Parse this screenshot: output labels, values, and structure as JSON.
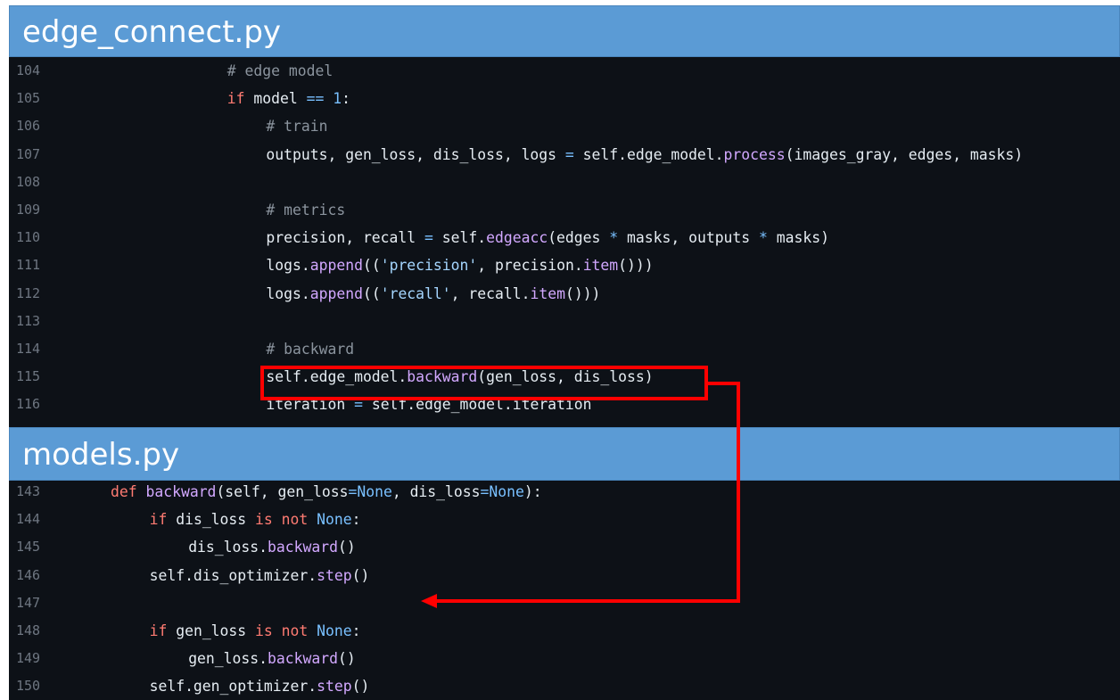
{
  "files": {
    "top": "edge_connect.py",
    "bottom": "models.py"
  },
  "colors": {
    "banner": "#5b9bd5",
    "code_bg": "#0d1117",
    "highlight": "#ff0000"
  },
  "top_code": [
    {
      "ln": "104",
      "indent": 16,
      "tokens": [
        [
          "cm",
          "# edge model"
        ]
      ]
    },
    {
      "ln": "105",
      "indent": 16,
      "tokens": [
        [
          "kw",
          "if"
        ],
        [
          "",
          " model "
        ],
        [
          "op",
          "=="
        ],
        [
          "",
          " "
        ],
        [
          "num",
          "1"
        ],
        [
          "",
          ":"
        ]
      ]
    },
    {
      "ln": "106",
      "indent": 20,
      "tokens": [
        [
          "cm",
          "# train"
        ]
      ]
    },
    {
      "ln": "107",
      "indent": 20,
      "tokens": [
        [
          "",
          "outputs, gen_loss, dis_loss, logs "
        ],
        [
          "op",
          "="
        ],
        [
          "",
          " self.edge_model."
        ],
        [
          "fn",
          "process"
        ],
        [
          "",
          "(images_gray, edges, masks)"
        ]
      ]
    },
    {
      "ln": "108",
      "indent": 0,
      "tokens": []
    },
    {
      "ln": "109",
      "indent": 20,
      "tokens": [
        [
          "cm",
          "# metrics"
        ]
      ]
    },
    {
      "ln": "110",
      "indent": 20,
      "tokens": [
        [
          "",
          "precision, recall "
        ],
        [
          "op",
          "="
        ],
        [
          "",
          " self."
        ],
        [
          "fn",
          "edgeacc"
        ],
        [
          "",
          "(edges "
        ],
        [
          "op",
          "*"
        ],
        [
          "",
          " masks, outputs "
        ],
        [
          "op",
          "*"
        ],
        [
          "",
          " masks)"
        ]
      ]
    },
    {
      "ln": "111",
      "indent": 20,
      "tokens": [
        [
          "",
          "logs."
        ],
        [
          "fn",
          "append"
        ],
        [
          "",
          "(("
        ],
        [
          "str",
          "'precision'"
        ],
        [
          "",
          ", precision."
        ],
        [
          "fn",
          "item"
        ],
        [
          "",
          "()))"
        ]
      ]
    },
    {
      "ln": "112",
      "indent": 20,
      "tokens": [
        [
          "",
          "logs."
        ],
        [
          "fn",
          "append"
        ],
        [
          "",
          "(("
        ],
        [
          "str",
          "'recall'"
        ],
        [
          "",
          ", recall."
        ],
        [
          "fn",
          "item"
        ],
        [
          "",
          "()))"
        ]
      ]
    },
    {
      "ln": "113",
      "indent": 0,
      "tokens": []
    },
    {
      "ln": "114",
      "indent": 20,
      "tokens": [
        [
          "cm",
          "# backward"
        ]
      ]
    },
    {
      "ln": "115",
      "indent": 20,
      "tokens": [
        [
          "",
          "self.edge_model."
        ],
        [
          "fn",
          "backward"
        ],
        [
          "",
          "(gen_loss, dis_loss)"
        ]
      ]
    },
    {
      "ln": "116",
      "indent": 20,
      "tokens": [
        [
          "",
          "iteration "
        ],
        [
          "op",
          "="
        ],
        [
          "",
          " self.edge_model.iteration"
        ]
      ]
    }
  ],
  "bottom_code": [
    {
      "ln": "143",
      "indent": 4,
      "tokens": [
        [
          "kw",
          "def"
        ],
        [
          "",
          " "
        ],
        [
          "fn",
          "backward"
        ],
        [
          "",
          "(self, gen_loss"
        ],
        [
          "op",
          "="
        ],
        [
          "num",
          "None"
        ],
        [
          "",
          ", dis_loss"
        ],
        [
          "op",
          "="
        ],
        [
          "num",
          "None"
        ],
        [
          "",
          "):"
        ]
      ]
    },
    {
      "ln": "144",
      "indent": 8,
      "tokens": [
        [
          "kw",
          "if"
        ],
        [
          "",
          " dis_loss "
        ],
        [
          "kw",
          "is not"
        ],
        [
          "",
          " "
        ],
        [
          "num",
          "None"
        ],
        [
          "",
          ":"
        ]
      ]
    },
    {
      "ln": "145",
      "indent": 12,
      "tokens": [
        [
          "",
          "dis_loss."
        ],
        [
          "fn",
          "backward"
        ],
        [
          "",
          "()"
        ]
      ]
    },
    {
      "ln": "146",
      "indent": 8,
      "tokens": [
        [
          "",
          "self.dis_optimizer."
        ],
        [
          "fn",
          "step"
        ],
        [
          "",
          "()"
        ]
      ]
    },
    {
      "ln": "147",
      "indent": 0,
      "tokens": []
    },
    {
      "ln": "148",
      "indent": 8,
      "tokens": [
        [
          "kw",
          "if"
        ],
        [
          "",
          " gen_loss "
        ],
        [
          "kw",
          "is not"
        ],
        [
          "",
          " "
        ],
        [
          "num",
          "None"
        ],
        [
          "",
          ":"
        ]
      ]
    },
    {
      "ln": "149",
      "indent": 12,
      "tokens": [
        [
          "",
          "gen_loss."
        ],
        [
          "fn",
          "backward"
        ],
        [
          "",
          "()"
        ]
      ]
    },
    {
      "ln": "150",
      "indent": 8,
      "tokens": [
        [
          "",
          "self.gen_optimizer."
        ],
        [
          "fn",
          "step"
        ],
        [
          "",
          "()"
        ]
      ]
    }
  ]
}
